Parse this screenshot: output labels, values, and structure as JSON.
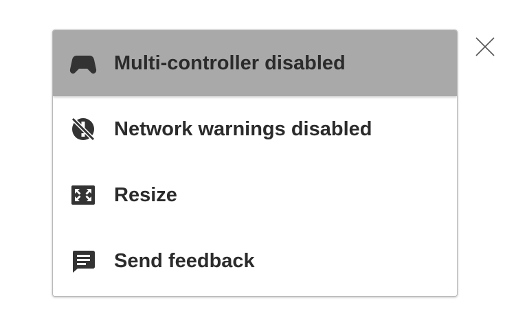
{
  "menu": {
    "items": [
      {
        "label": "Multi-controller disabled",
        "icon": "gamepad-icon",
        "active": true
      },
      {
        "label": "Network warnings disabled",
        "icon": "no-network-warning-icon",
        "active": false
      },
      {
        "label": "Resize",
        "icon": "resize-icon",
        "active": false
      },
      {
        "label": "Send feedback",
        "icon": "feedback-icon",
        "active": false
      }
    ]
  },
  "close": {
    "icon": "close-icon"
  },
  "colors": {
    "active_background": "#a9a9a9",
    "text": "#2b2b2b",
    "icon": "#333333",
    "border": "#b9b9b9"
  }
}
